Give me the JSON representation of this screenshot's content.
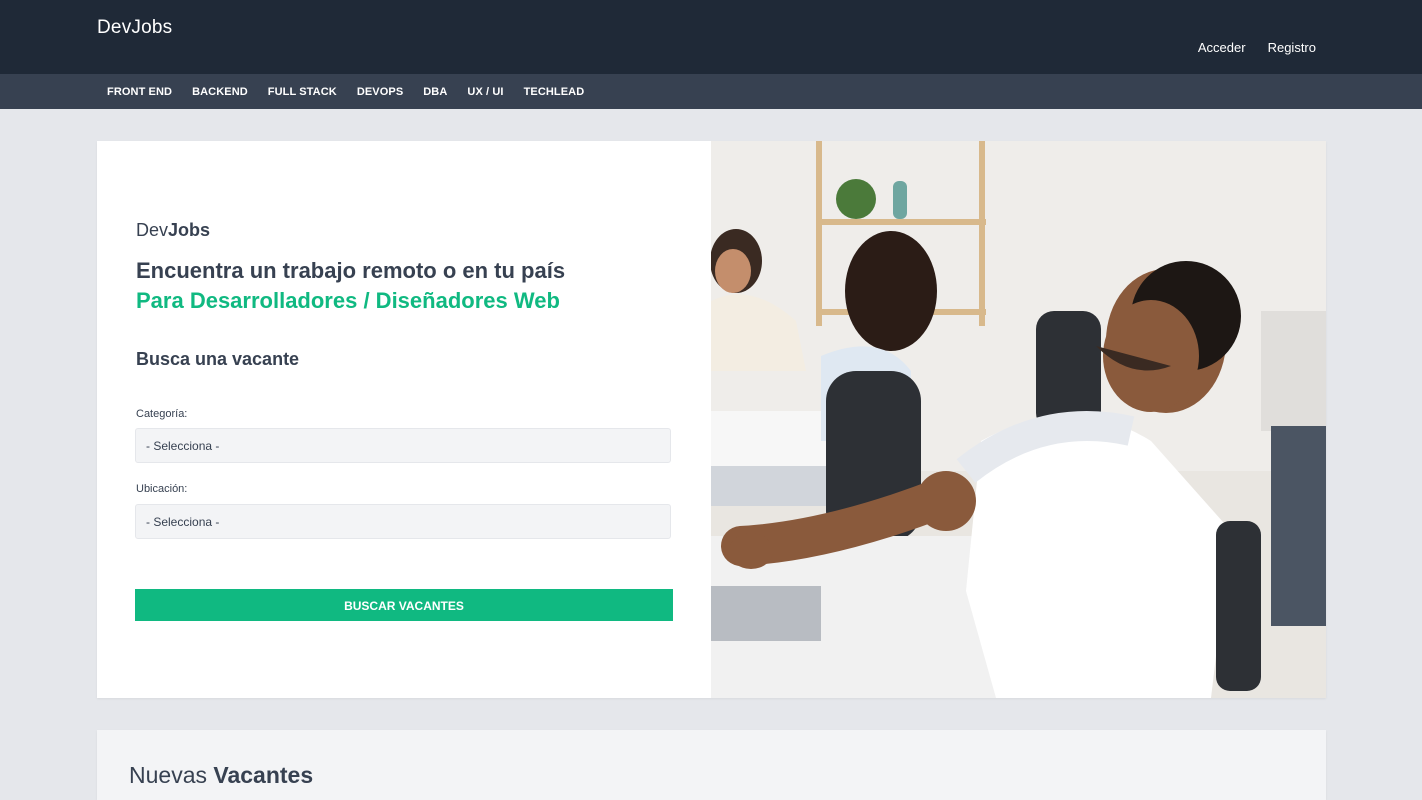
{
  "header": {
    "brand": "DevJobs",
    "links": {
      "login": "Acceder",
      "register": "Registro"
    }
  },
  "categories": [
    "FRONT END",
    "BACKEND",
    "FULL STACK",
    "DEVOPS",
    "DBA",
    "UX / UI",
    "TECHLEAD"
  ],
  "hero": {
    "logo_prefix": "Dev",
    "logo_bold": "Jobs",
    "heading": "Encuentra un trabajo remoto o en tu país",
    "heading_accent": "Para Desarrolladores / Diseñadores Web",
    "subtitle": "Busca una vacante",
    "form": {
      "category_label": "Categoría:",
      "category_value": "- Selecciona -",
      "location_label": "Ubicación:",
      "location_value": "- Selecciona -",
      "submit": "BUSCAR VACANTES"
    }
  },
  "new_jobs": {
    "title_prefix": "Nuevas",
    "title_bold": "Vacantes"
  },
  "colors": {
    "primary": "#1f2937",
    "secondary": "#374151",
    "accent": "#10b981",
    "bg": "#e5e7eb"
  }
}
